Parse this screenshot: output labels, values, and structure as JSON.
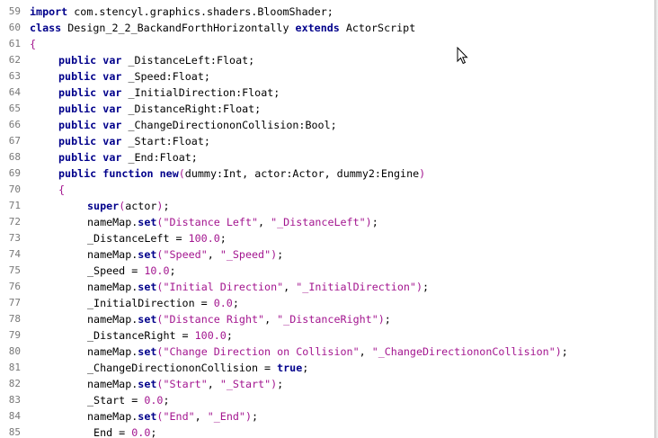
{
  "editor": {
    "lines": [
      {
        "num": "59",
        "indent": 0,
        "tokens": [
          {
            "t": "kw",
            "v": "import"
          },
          {
            "t": "p",
            "v": " com.stencyl.graphics.shaders.BloomShader;"
          }
        ]
      },
      {
        "num": "60",
        "indent": 0,
        "tokens": [
          {
            "t": "kw",
            "v": "class"
          },
          {
            "t": "p",
            "v": " Design_2_2_BackandForthHorizontally "
          },
          {
            "t": "kw",
            "v": "extends"
          },
          {
            "t": "p",
            "v": " ActorScript"
          }
        ]
      },
      {
        "num": "61",
        "indent": 0,
        "tokens": [
          {
            "t": "par",
            "v": "{"
          }
        ]
      },
      {
        "num": "62",
        "indent": 1,
        "tokens": [
          {
            "t": "kw",
            "v": "public"
          },
          {
            "t": "p",
            "v": " "
          },
          {
            "t": "kw",
            "v": "var"
          },
          {
            "t": "p",
            "v": " _DistanceLeft:Float;"
          }
        ]
      },
      {
        "num": "63",
        "indent": 1,
        "tokens": [
          {
            "t": "kw",
            "v": "public"
          },
          {
            "t": "p",
            "v": " "
          },
          {
            "t": "kw",
            "v": "var"
          },
          {
            "t": "p",
            "v": " _Speed:Float;"
          }
        ]
      },
      {
        "num": "64",
        "indent": 1,
        "tokens": [
          {
            "t": "kw",
            "v": "public"
          },
          {
            "t": "p",
            "v": " "
          },
          {
            "t": "kw",
            "v": "var"
          },
          {
            "t": "p",
            "v": " _InitialDirection:Float;"
          }
        ]
      },
      {
        "num": "65",
        "indent": 1,
        "tokens": [
          {
            "t": "kw",
            "v": "public"
          },
          {
            "t": "p",
            "v": " "
          },
          {
            "t": "kw",
            "v": "var"
          },
          {
            "t": "p",
            "v": " _DistanceRight:Float;"
          }
        ]
      },
      {
        "num": "66",
        "indent": 1,
        "tokens": [
          {
            "t": "kw",
            "v": "public"
          },
          {
            "t": "p",
            "v": " "
          },
          {
            "t": "kw",
            "v": "var"
          },
          {
            "t": "p",
            "v": " _ChangeDirectiononCollision:Bool;"
          }
        ]
      },
      {
        "num": "67",
        "indent": 1,
        "tokens": [
          {
            "t": "kw",
            "v": "public"
          },
          {
            "t": "p",
            "v": " "
          },
          {
            "t": "kw",
            "v": "var"
          },
          {
            "t": "p",
            "v": " _Start:Float;"
          }
        ]
      },
      {
        "num": "68",
        "indent": 1,
        "tokens": [
          {
            "t": "kw",
            "v": "public"
          },
          {
            "t": "p",
            "v": " "
          },
          {
            "t": "kw",
            "v": "var"
          },
          {
            "t": "p",
            "v": " _End:Float;"
          }
        ]
      },
      {
        "num": "69",
        "indent": 1,
        "tokens": [
          {
            "t": "kw",
            "v": "public"
          },
          {
            "t": "p",
            "v": " "
          },
          {
            "t": "kw",
            "v": "function"
          },
          {
            "t": "p",
            "v": " "
          },
          {
            "t": "kw",
            "v": "new"
          },
          {
            "t": "par",
            "v": "("
          },
          {
            "t": "p",
            "v": "dummy:Int, actor:Actor, dummy2:Engine"
          },
          {
            "t": "par",
            "v": ")"
          }
        ]
      },
      {
        "num": "70",
        "indent": 1,
        "tokens": [
          {
            "t": "par",
            "v": "{"
          }
        ]
      },
      {
        "num": "71",
        "indent": 2,
        "tokens": [
          {
            "t": "kw",
            "v": "super"
          },
          {
            "t": "par",
            "v": "("
          },
          {
            "t": "p",
            "v": "actor"
          },
          {
            "t": "par",
            "v": ")"
          },
          {
            "t": "p",
            "v": ";"
          }
        ]
      },
      {
        "num": "72",
        "indent": 2,
        "tokens": [
          {
            "t": "p",
            "v": "nameMap."
          },
          {
            "t": "kw",
            "v": "set"
          },
          {
            "t": "par",
            "v": "("
          },
          {
            "t": "str",
            "v": "\"Distance Left\""
          },
          {
            "t": "p",
            "v": ", "
          },
          {
            "t": "str",
            "v": "\"_DistanceLeft\""
          },
          {
            "t": "par",
            "v": ")"
          },
          {
            "t": "p",
            "v": ";"
          }
        ]
      },
      {
        "num": "73",
        "indent": 2,
        "tokens": [
          {
            "t": "p",
            "v": "_DistanceLeft = "
          },
          {
            "t": "num",
            "v": "100.0"
          },
          {
            "t": "p",
            "v": ";"
          }
        ]
      },
      {
        "num": "74",
        "indent": 2,
        "tokens": [
          {
            "t": "p",
            "v": "nameMap."
          },
          {
            "t": "kw",
            "v": "set"
          },
          {
            "t": "par",
            "v": "("
          },
          {
            "t": "str",
            "v": "\"Speed\""
          },
          {
            "t": "p",
            "v": ", "
          },
          {
            "t": "str",
            "v": "\"_Speed\""
          },
          {
            "t": "par",
            "v": ")"
          },
          {
            "t": "p",
            "v": ";"
          }
        ]
      },
      {
        "num": "75",
        "indent": 2,
        "tokens": [
          {
            "t": "p",
            "v": "_Speed = "
          },
          {
            "t": "num",
            "v": "10.0"
          },
          {
            "t": "p",
            "v": ";"
          }
        ]
      },
      {
        "num": "76",
        "indent": 2,
        "tokens": [
          {
            "t": "p",
            "v": "nameMap."
          },
          {
            "t": "kw",
            "v": "set"
          },
          {
            "t": "par",
            "v": "("
          },
          {
            "t": "str",
            "v": "\"Initial Direction\""
          },
          {
            "t": "p",
            "v": ", "
          },
          {
            "t": "str",
            "v": "\"_InitialDirection\""
          },
          {
            "t": "par",
            "v": ")"
          },
          {
            "t": "p",
            "v": ";"
          }
        ]
      },
      {
        "num": "77",
        "indent": 2,
        "tokens": [
          {
            "t": "p",
            "v": "_InitialDirection = "
          },
          {
            "t": "num",
            "v": "0.0"
          },
          {
            "t": "p",
            "v": ";"
          }
        ]
      },
      {
        "num": "78",
        "indent": 2,
        "tokens": [
          {
            "t": "p",
            "v": "nameMap."
          },
          {
            "t": "kw",
            "v": "set"
          },
          {
            "t": "par",
            "v": "("
          },
          {
            "t": "str",
            "v": "\"Distance Right\""
          },
          {
            "t": "p",
            "v": ", "
          },
          {
            "t": "str",
            "v": "\"_DistanceRight\""
          },
          {
            "t": "par",
            "v": ")"
          },
          {
            "t": "p",
            "v": ";"
          }
        ]
      },
      {
        "num": "79",
        "indent": 2,
        "tokens": [
          {
            "t": "p",
            "v": "_DistanceRight = "
          },
          {
            "t": "num",
            "v": "100.0"
          },
          {
            "t": "p",
            "v": ";"
          }
        ]
      },
      {
        "num": "80",
        "indent": 2,
        "tokens": [
          {
            "t": "p",
            "v": "nameMap."
          },
          {
            "t": "kw",
            "v": "set"
          },
          {
            "t": "par",
            "v": "("
          },
          {
            "t": "str",
            "v": "\"Change Direction on Collision\""
          },
          {
            "t": "p",
            "v": ", "
          },
          {
            "t": "str",
            "v": "\"_ChangeDirectiononCollision\""
          },
          {
            "t": "par",
            "v": ")"
          },
          {
            "t": "p",
            "v": ";"
          }
        ]
      },
      {
        "num": "81",
        "indent": 2,
        "tokens": [
          {
            "t": "p",
            "v": "_ChangeDirectiononCollision = "
          },
          {
            "t": "kw",
            "v": "true"
          },
          {
            "t": "p",
            "v": ";"
          }
        ]
      },
      {
        "num": "82",
        "indent": 2,
        "tokens": [
          {
            "t": "p",
            "v": "nameMap."
          },
          {
            "t": "kw",
            "v": "set"
          },
          {
            "t": "par",
            "v": "("
          },
          {
            "t": "str",
            "v": "\"Start\""
          },
          {
            "t": "p",
            "v": ", "
          },
          {
            "t": "str",
            "v": "\"_Start\""
          },
          {
            "t": "par",
            "v": ")"
          },
          {
            "t": "p",
            "v": ";"
          }
        ]
      },
      {
        "num": "83",
        "indent": 2,
        "tokens": [
          {
            "t": "p",
            "v": "_Start = "
          },
          {
            "t": "num",
            "v": "0.0"
          },
          {
            "t": "p",
            "v": ";"
          }
        ]
      },
      {
        "num": "84",
        "indent": 2,
        "tokens": [
          {
            "t": "p",
            "v": "nameMap."
          },
          {
            "t": "kw",
            "v": "set"
          },
          {
            "t": "par",
            "v": "("
          },
          {
            "t": "str",
            "v": "\"End\""
          },
          {
            "t": "p",
            "v": ", "
          },
          {
            "t": "str",
            "v": "\"_End\""
          },
          {
            "t": "par",
            "v": ")"
          },
          {
            "t": "p",
            "v": ";"
          }
        ]
      },
      {
        "num": "85",
        "indent": 2,
        "tokens": [
          {
            "t": "p",
            "v": "_End = "
          },
          {
            "t": "num",
            "v": "0.0"
          },
          {
            "t": "p",
            "v": ";"
          }
        ]
      }
    ]
  },
  "colors": {
    "keyword": "#00008b",
    "string": "#a3158f",
    "line_number": "#787878",
    "text": "#000000"
  },
  "icons": {
    "cursor": "mouse-pointer-icon"
  }
}
